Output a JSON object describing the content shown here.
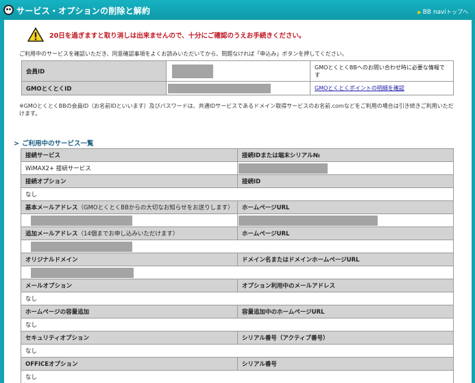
{
  "header": {
    "title": "サービス・オプションの削除と解約",
    "nav_link_main": "BB navi",
    "nav_link_sub": "トップへ"
  },
  "warning": {
    "icon": "warning-triangle-icon",
    "text": "20日を過ぎますと取り消しは出来ませんので、十分にご確認のうえお手続きください。"
  },
  "intro": "ご利用中のサービスを確認いただき、同意確認事項をよくお読みいただいてから、問題なければ「申込み」ボタンを押してください。",
  "id_table": {
    "member_id_label": "会員ID",
    "member_id_note": "GMOとくとくBBへのお問い合わせ時に必要な情報です",
    "gmo_id_label": "GMOとくとくID",
    "gmo_id_link": "GMOとくとくポイントの明細を確認"
  },
  "footnote": "※GMOとくとくBBの会員ID（お名前IDといいます）及びパスワードは、共通IDサービスであるドメイン取得サービスのお名前.comなどをご利用の場合は引き続きご利用いただけます。",
  "services_heading": "ご利用中のサービス一覧",
  "services": {
    "connection_service": "接続サービス",
    "connection_id_or_serial": "接続IDまたは端末シリアル№",
    "connection_service_value": "WiMAX2+ 接続サービス",
    "connection_option": "接続オプション",
    "connection_id": "接続ID",
    "connection_option_value": "なし",
    "basic_mail": "基本メールアドレス",
    "basic_mail_note": "（GMOとくとくBBからの大切なお知らせをお送りします）",
    "homepage_url": "ホームページURL",
    "extra_mail": "追加メールアドレス",
    "extra_mail_note": "（14個までお申し込みいただけます）",
    "homepage_url_2": "ホームページURL",
    "original_domain": "オリジナルドメイン",
    "domain_or_homepage": "ドメイン名またはドメインホームページURL",
    "mail_option": "メールオプション",
    "mail_option_address": "オプション利用中のメールアドレス",
    "mail_option_value": "なし",
    "homepage_capacity": "ホームページの容量追加",
    "capacity_url": "容量追加中のホームページURL",
    "homepage_capacity_value": "なし",
    "security_option": "セキュリティオプション",
    "serial_activation": "シリアル番号（アクティブ番号）",
    "security_option_value": "なし",
    "office_option": "OFFICEオプション",
    "serial_number": "シリアル番号",
    "office_option_value": "なし"
  }
}
